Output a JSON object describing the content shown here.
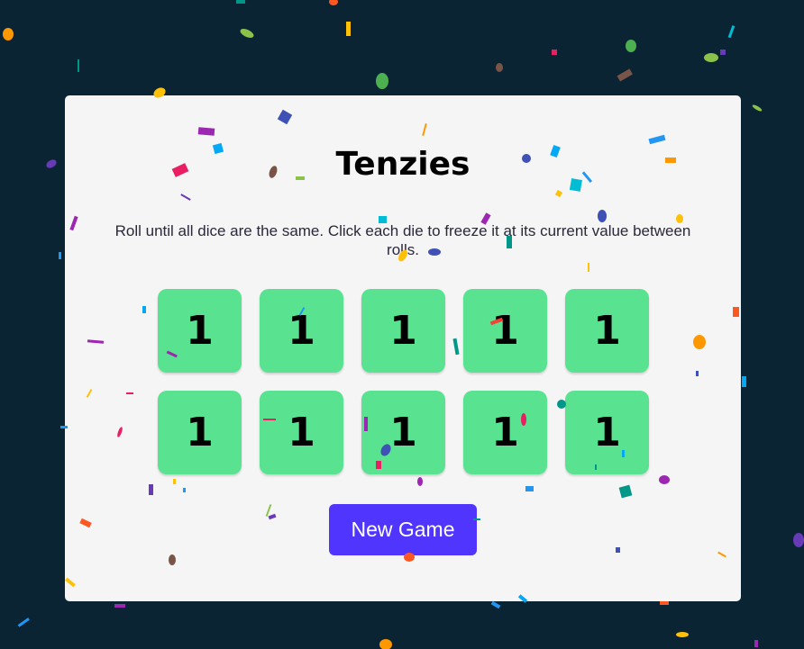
{
  "game": {
    "title": "Tenzies",
    "instructions": "Roll until all dice are the same. Click each die to freeze it at its current value between rolls.",
    "dice": [
      {
        "value": "1",
        "held": false
      },
      {
        "value": "1",
        "held": false
      },
      {
        "value": "1",
        "held": false
      },
      {
        "value": "1",
        "held": false
      },
      {
        "value": "1",
        "held": false
      },
      {
        "value": "1",
        "held": false
      },
      {
        "value": "1",
        "held": false
      },
      {
        "value": "1",
        "held": false
      },
      {
        "value": "1",
        "held": false
      },
      {
        "value": "1",
        "held": false
      }
    ],
    "button_label": "New Game"
  },
  "colors": {
    "background": "#0b2434",
    "board": "#f5f5f5",
    "die": "#59e391",
    "button": "#5035ff"
  },
  "confetti_colors": [
    "#e91e63",
    "#9c27b0",
    "#673ab7",
    "#3f51b5",
    "#2196f3",
    "#03a9f4",
    "#00bcd4",
    "#009688",
    "#4caf50",
    "#8bc34a",
    "#ffc107",
    "#ff9800",
    "#ff5722",
    "#795548"
  ]
}
